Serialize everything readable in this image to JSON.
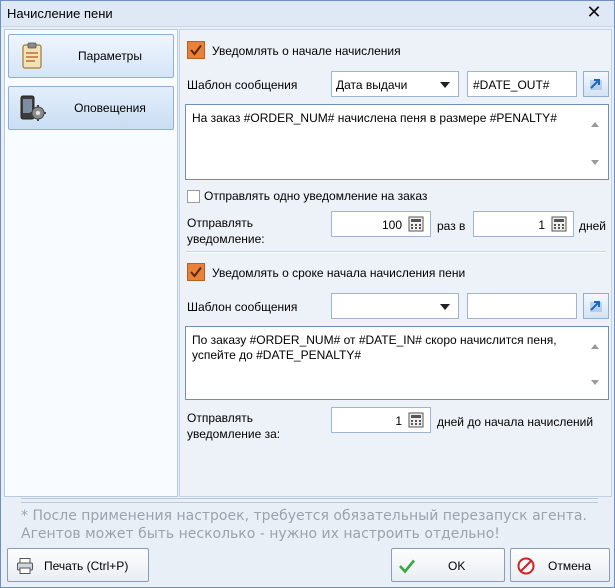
{
  "window": {
    "title": "Начисление пени",
    "close_glyph": "✕"
  },
  "nav": {
    "params_label": "Параметры",
    "notify_label": "Оповещения",
    "params_icon": "clipboard-icon",
    "notify_icon": "phone-gear-icon"
  },
  "section1": {
    "checkbox_label": "Уведомлять о начале начисления",
    "checked": true,
    "template_label": "Шаблон сообщения",
    "template_combo_value": "Дата выдачи",
    "template_var_value": "#DATE_OUT#",
    "message_text": "На заказ #ORDER_NUM# начислена пеня в размере #PENALTY#",
    "one_per_order_label": "Отправлять одно уведомление на заказ",
    "one_per_order_checked": false,
    "send_label_line1": "Отправлять",
    "send_label_line2": "уведомление:",
    "count_value": "100",
    "times_in_label": "раз в",
    "days_value": "1",
    "days_label": "дней"
  },
  "section2": {
    "checkbox_label": "Уведомлять о сроке начала начисления пени",
    "checked": true,
    "template_label": "Шаблон сообщения",
    "template_combo_value": "",
    "template_var_value": "",
    "message_text": "По заказу #ORDER_NUM# от #DATE_IN# скоро начислится пеня,\nуспейте до #DATE_PENALTY#",
    "send_label_line1": "Отправлять",
    "send_label_line2": "уведомление за:",
    "days_before_value": "1",
    "days_before_label": "дней до начала начислений"
  },
  "notes": {
    "line1": "* После применения настроек, требуется обязательный перезапуск агента.",
    "line2": "Агентов может быть несколько - нужно их настроить отдельно!"
  },
  "buttons": {
    "print_label": "Печать (Ctrl+P)",
    "ok_label": "OK",
    "cancel_label": "Отмена"
  },
  "colors": {
    "accent_checkbox": "#e8823a",
    "ok_icon": "#3aa83a",
    "cancel_icon": "#d22020"
  }
}
